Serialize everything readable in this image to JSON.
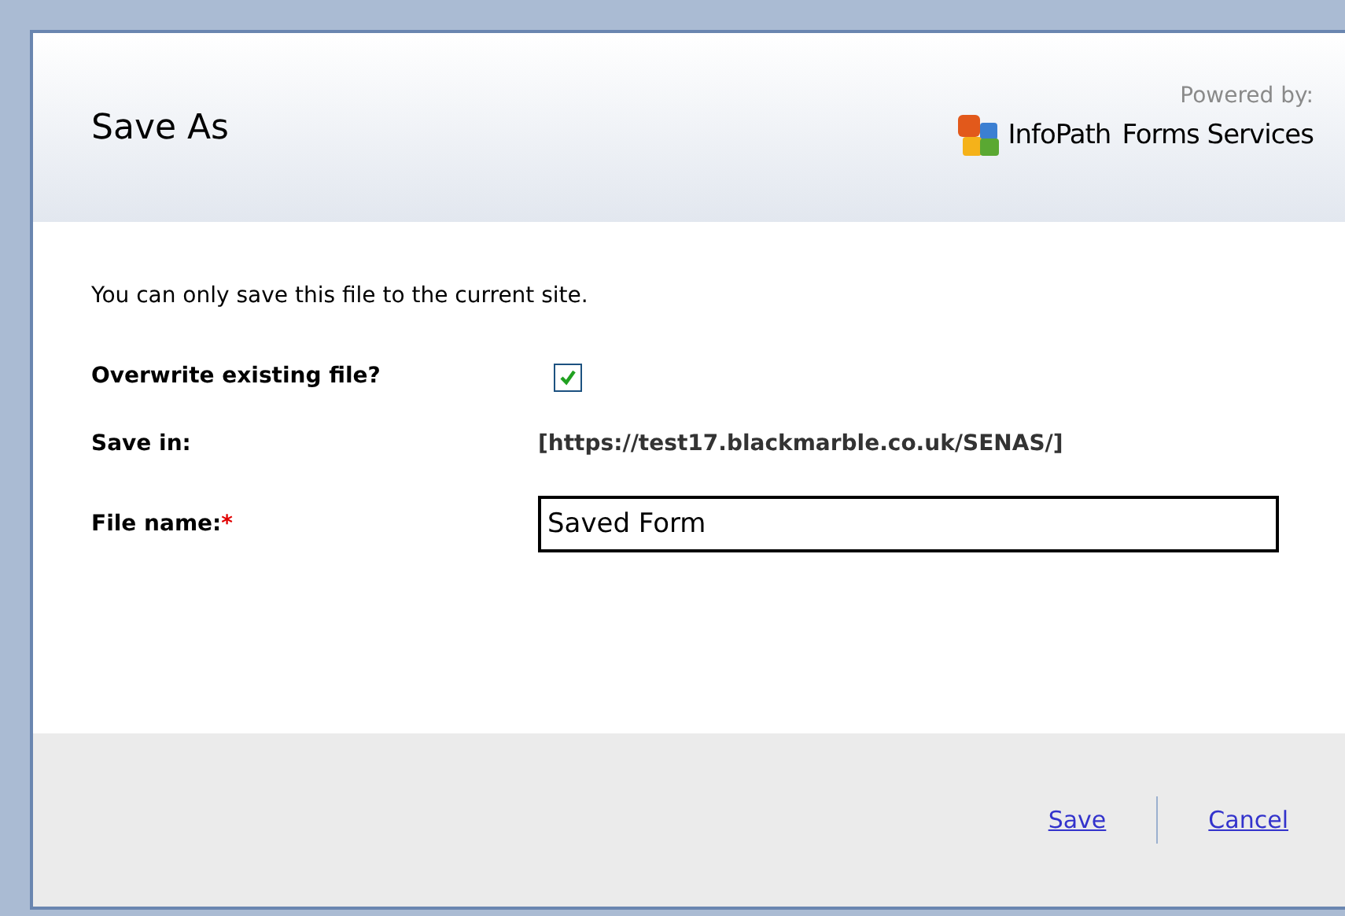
{
  "dialog": {
    "title": "Save As",
    "powered_by": "Powered by:",
    "product": "InfoPath",
    "product_suffix": "Forms Services",
    "message": "You can only save this file to the current site.",
    "overwrite": {
      "label": "Overwrite existing file?",
      "checked": true
    },
    "save_in": {
      "label": "Save in:",
      "value": "[https://test17.blackmarble.co.uk/SENAS/]"
    },
    "file_name": {
      "label": "File name:",
      "required_mark": "*",
      "value": "Saved Form"
    },
    "buttons": [
      {
        "label": "Save"
      },
      {
        "label": "Cancel"
      }
    ]
  }
}
